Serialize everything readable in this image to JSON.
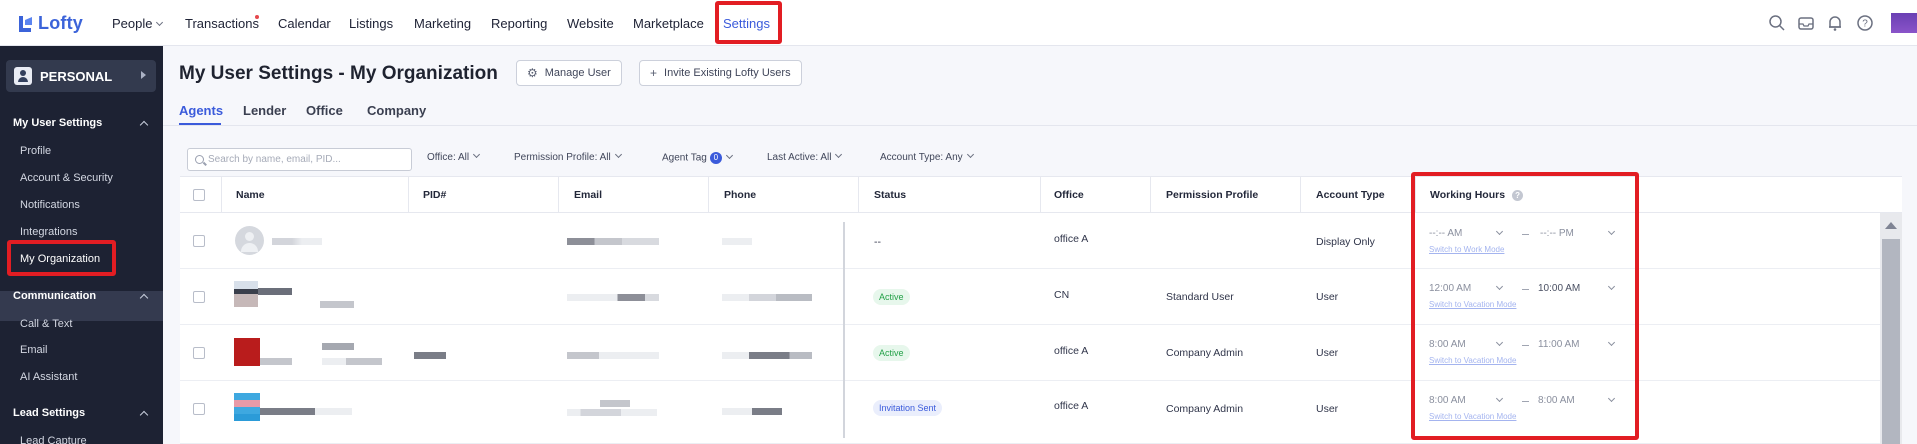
{
  "app": {
    "name": "Lofty"
  },
  "nav": {
    "items": [
      {
        "label": "People",
        "dropdown": true
      },
      {
        "label": "Transactions"
      },
      {
        "label": "Calendar"
      },
      {
        "label": "Listings"
      },
      {
        "label": "Marketing"
      },
      {
        "label": "Reporting"
      },
      {
        "label": "Website"
      },
      {
        "label": "Marketplace"
      },
      {
        "label": "Settings",
        "active": true
      }
    ],
    "icons": [
      "search-icon",
      "inbox-icon",
      "bell-icon",
      "help-icon"
    ]
  },
  "sidebar": {
    "workspace": "PERSONAL",
    "sections": [
      {
        "title": "My User Settings",
        "items": [
          "Profile",
          "Account & Security",
          "Notifications",
          "Integrations",
          "My Organization"
        ]
      },
      {
        "title": "Communication",
        "items": [
          "Call & Text",
          "Email",
          "AI Assistant"
        ]
      },
      {
        "title": "Lead Settings",
        "items": [
          "Lead Capture"
        ]
      }
    ],
    "active_item": "My Organization"
  },
  "page": {
    "title": "My User Settings - My Organization",
    "manage_user": "Manage User",
    "invite_users": "Invite Existing Lofty Users",
    "tabs": [
      "Agents",
      "Lender",
      "Office",
      "Company"
    ],
    "active_tab": "Agents"
  },
  "filters": {
    "search_placeholder": "Search by name, email, PID...",
    "office": "Office: All",
    "permission_profile": "Permission Profile: All",
    "agent_tag": "Agent Tag",
    "agent_tag_count": "0",
    "last_active": "Last Active: All",
    "account_type": "Account Type: Any"
  },
  "table": {
    "columns": [
      "Name",
      "PID#",
      "Email",
      "Phone",
      "Status",
      "Office",
      "Permission Profile",
      "Account Type",
      "Working Hours"
    ],
    "working_hours_info": "?",
    "rows": [
      {
        "status": "--",
        "office": "office A",
        "permission": "",
        "account_type": "Display Only",
        "start": "--:-- AM",
        "end": "--:-- PM",
        "link": "Switch to Work Mode"
      },
      {
        "status": "Active",
        "office": "CN",
        "permission": "Standard User",
        "account_type": "User",
        "start": "12:00 AM",
        "end": "10:00 AM",
        "link": "Switch to Vacation Mode"
      },
      {
        "status": "Active",
        "office": "office A",
        "permission": "Company Admin",
        "account_type": "User",
        "start": "8:00 AM",
        "end": "11:00 AM",
        "link": "Switch to Vacation Mode"
      },
      {
        "status": "Invitation Sent",
        "office": "office A",
        "permission": "Company Admin",
        "account_type": "User",
        "start": "8:00 AM",
        "end": "8:00 AM",
        "link": "Switch to Vacation Mode"
      }
    ]
  },
  "colors": {
    "accent": "#3b5bdb",
    "highlight": "#e21d23",
    "sidebar": "#1d2233"
  }
}
